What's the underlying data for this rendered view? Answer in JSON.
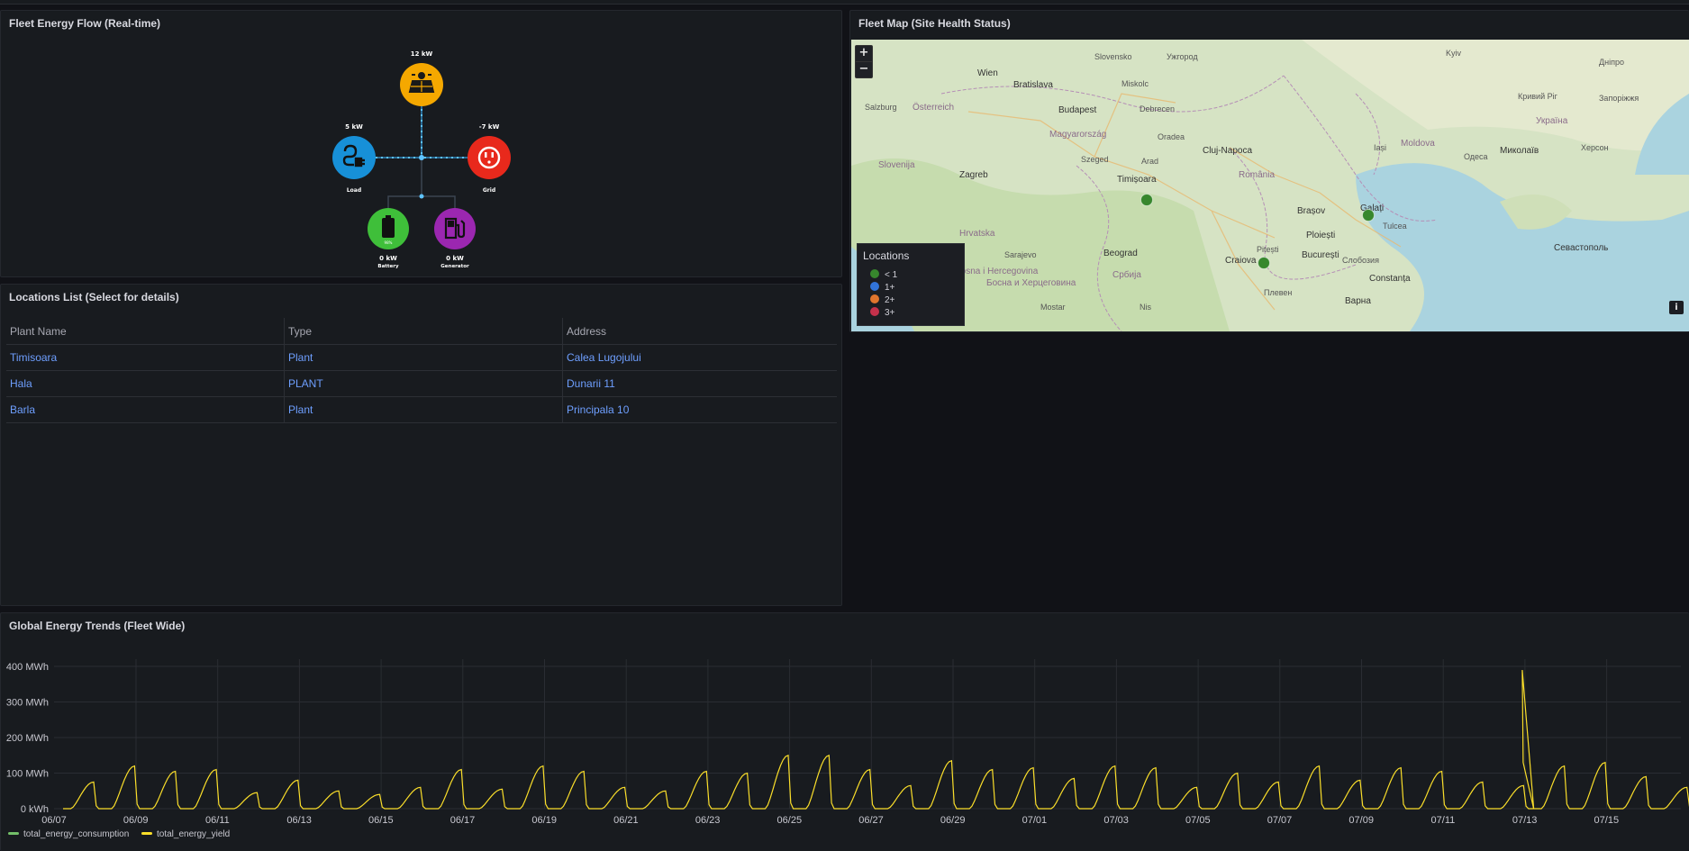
{
  "flow_panel": {
    "title": "Fleet Energy Flow (Real-time)",
    "solar": {
      "value": "12 kW",
      "color": "#f5a800"
    },
    "load": {
      "value": "5 kW",
      "label": "Load",
      "color": "#1790d8"
    },
    "grid": {
      "value": "-7 kW",
      "label": "Grid",
      "color": "#e8291c"
    },
    "battery": {
      "value": "0 kW",
      "label": "Battery",
      "pct": "98%",
      "color": "#3fbf3a"
    },
    "generator": {
      "value": "0 kW",
      "label": "Generator",
      "color": "#9b27b0"
    }
  },
  "map_panel": {
    "title": "Fleet Map (Site Health Status)",
    "zoom_in": "+",
    "zoom_out": "−",
    "info": "i",
    "legend": {
      "title": "Locations",
      "items": [
        {
          "label": "< 1",
          "color": "#37872d"
        },
        {
          "label": "1+",
          "color": "#3274d9"
        },
        {
          "label": "2+",
          "color": "#e0752d"
        },
        {
          "label": "3+",
          "color": "#c4314b"
        }
      ]
    },
    "labels": [
      "Slovensko",
      "Wien",
      "Bratislava",
      "Salzburg",
      "Österreich",
      "Budapest",
      "Magyarország",
      "Debrecen",
      "Miskolc",
      "Ужгород",
      "Cluj-Napoca",
      "Oradea",
      "România",
      "Arad",
      "Timișoara",
      "Szeged",
      "Zagreb",
      "Hrvatska",
      "Slovenija",
      "Beograd",
      "Србија",
      "Craiova",
      "Pitești",
      "București",
      "Brașov",
      "Ploiești",
      "Galați",
      "Tulcea",
      "Constanța",
      "Iași",
      "Moldova",
      "Україна",
      "Одеса",
      "Миколаїв",
      "Херсон",
      "Севастополь",
      "Bosna i Hercegovina",
      "Босна и Херцеговина",
      "Варна",
      "Плевен",
      "Слобозия",
      "Днiпро",
      "Запоріжжя",
      "Кривий Ріг",
      "Kyiv",
      "Sarajevo",
      "Mostar",
      "Nis"
    ],
    "markers": [
      {
        "name": "Timisoara",
        "color": "#37872d"
      },
      {
        "name": "Barla",
        "color": "#37872d"
      },
      {
        "name": "Galati",
        "color": "#37872d"
      }
    ]
  },
  "locations_panel": {
    "title": "Locations List (Select for details)",
    "columns": [
      "Plant Name",
      "Type",
      "Address"
    ],
    "rows": [
      [
        "Timisoara",
        "Plant",
        "Calea Lugojului"
      ],
      [
        "Hala",
        "PLANT",
        "Dunarii 11"
      ],
      [
        "Barla",
        "Plant",
        "Principala 10"
      ]
    ]
  },
  "trends_panel": {
    "title": "Global Energy Trends (Fleet Wide)",
    "legend": [
      {
        "name": "total_energy_consumption",
        "color": "#73bf69"
      },
      {
        "name": "total_energy_yield",
        "color": "#fade2a"
      }
    ]
  },
  "chart_data": {
    "type": "line",
    "title": "Global Energy Trends (Fleet Wide)",
    "y_unit": "MWh",
    "ylim": [
      0,
      400
    ],
    "yticks": [
      "0 kWh",
      "100 MWh",
      "200 MWh",
      "300 MWh",
      "400 MWh"
    ],
    "xticks": [
      "06/07",
      "06/09",
      "06/11",
      "06/13",
      "06/15",
      "06/17",
      "06/19",
      "06/21",
      "06/23",
      "06/25",
      "06/27",
      "06/29",
      "07/01",
      "07/03",
      "07/05",
      "07/07",
      "07/09",
      "07/11",
      "07/13",
      "07/15"
    ],
    "series": [
      {
        "name": "total_energy_consumption",
        "values": []
      },
      {
        "name": "total_energy_yield",
        "daily_peaks_MWh": [
          75,
          120,
          105,
          110,
          45,
          80,
          50,
          40,
          60,
          110,
          55,
          120,
          105,
          60,
          50,
          105,
          100,
          150,
          150,
          110,
          65,
          135,
          110,
          115,
          85,
          120,
          115,
          60,
          100,
          75,
          120,
          80,
          115,
          105,
          75,
          65,
          120,
          130,
          90,
          60,
          70
        ]
      }
    ],
    "grid": true,
    "legend": "bottom-left"
  }
}
